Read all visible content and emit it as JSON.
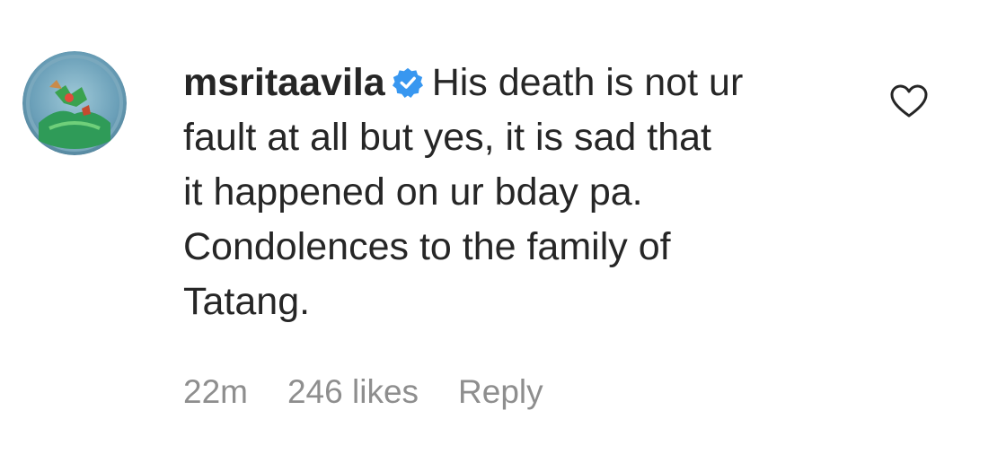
{
  "comment": {
    "username": "msritaavila",
    "verified_icon": "verified-badge-icon",
    "lines": [
      "His death is not ur",
      "fault at all but yes, it is sad that",
      "it happened on ur bday pa.",
      "Condolences to the family of",
      "Tatang."
    ],
    "time": "22m",
    "likes": "246 likes",
    "reply_label": "Reply",
    "like_icon": "heart-outline-icon"
  },
  "colors": {
    "text": "#262626",
    "meta": "#8e8e8e",
    "verified": "#3897f0"
  }
}
